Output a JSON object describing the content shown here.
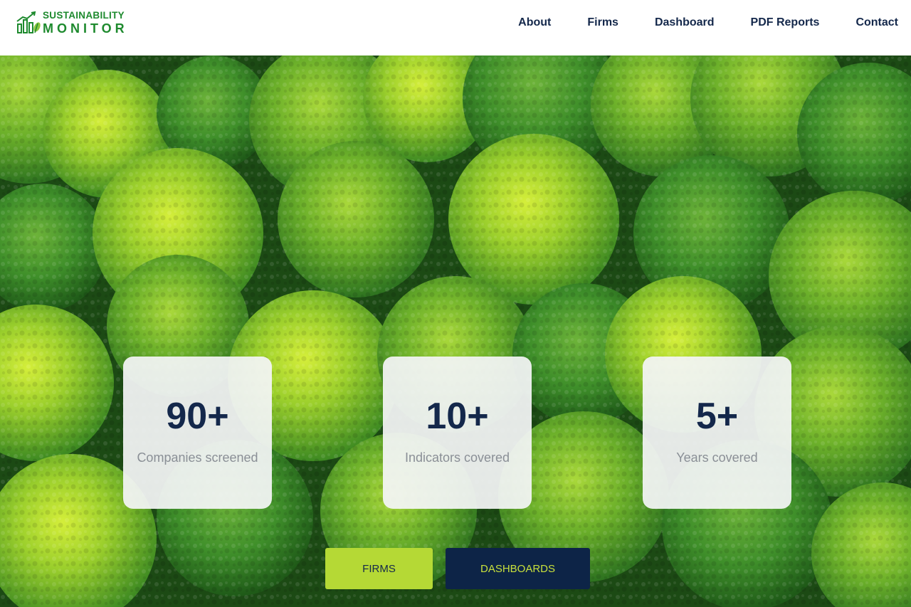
{
  "brand": {
    "line1": "SUSTAINABILITY",
    "line2": "MONITOR",
    "color": "#1e8a2e",
    "icon": "bar-chart-leaf-icon"
  },
  "nav": {
    "items": [
      {
        "label": "About"
      },
      {
        "label": "Firms"
      },
      {
        "label": "Dashboard"
      },
      {
        "label": "PDF Reports"
      },
      {
        "label": "Contact"
      }
    ]
  },
  "hero": {
    "background": "aerial-forest-canopy",
    "stats": [
      {
        "value": "90+",
        "label": "Companies screened"
      },
      {
        "value": "10+",
        "label": "Indicators covered"
      },
      {
        "value": "5+",
        "label": "Years covered"
      }
    ],
    "buttons": {
      "firms_label": "FIRMS",
      "dashboards_label": "DASHBOARDS"
    }
  },
  "colors": {
    "navy": "#14284b",
    "lime": "#b5d935",
    "dark_navy": "#0d2447"
  }
}
